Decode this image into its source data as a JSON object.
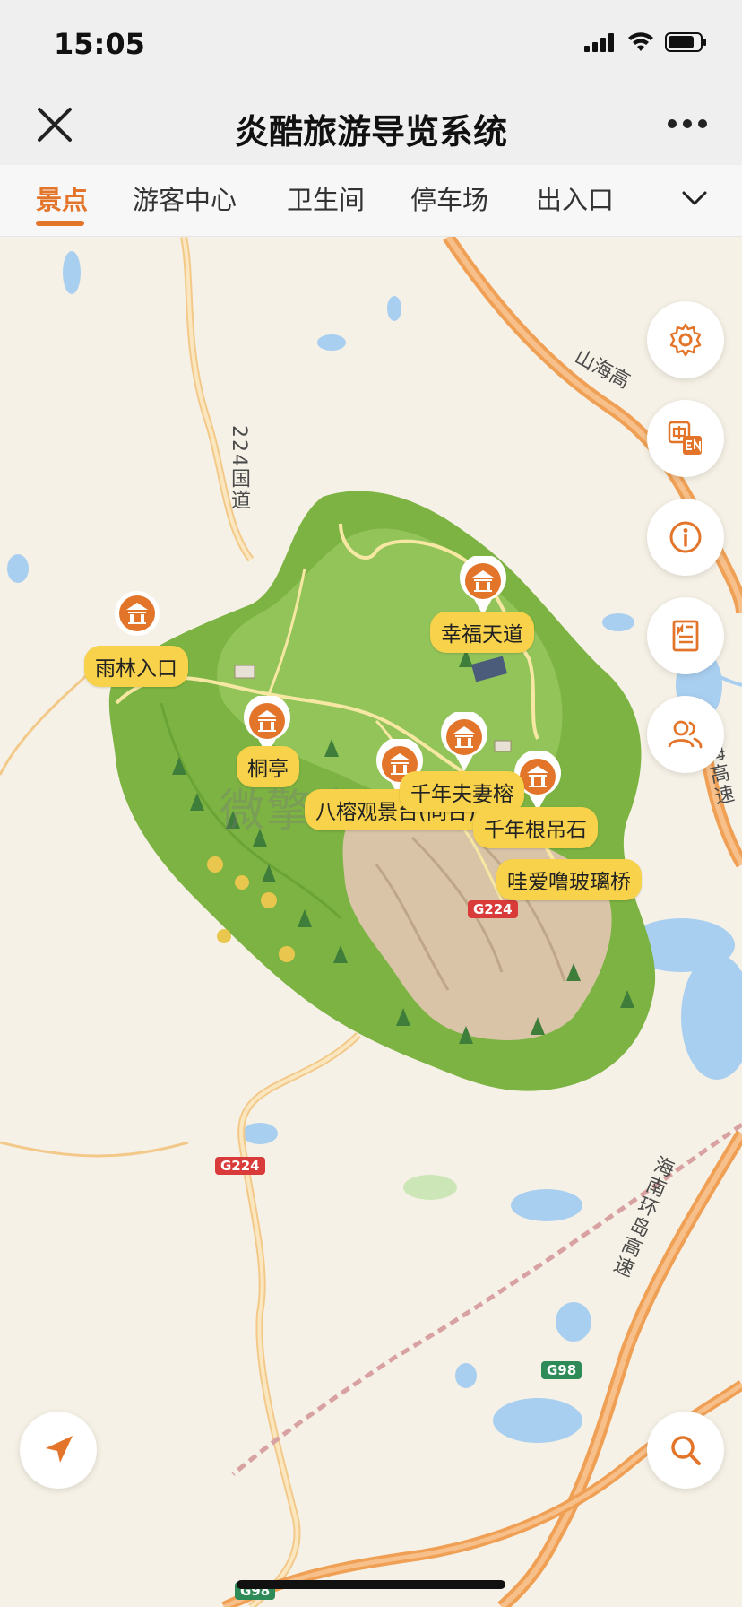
{
  "status_bar": {
    "time": "15:05"
  },
  "nav": {
    "title": "炎酷旅游导览系统"
  },
  "tabs": [
    {
      "label": "景点",
      "active": true
    },
    {
      "label": "游客中心",
      "active": false
    },
    {
      "label": "卫生间",
      "active": false
    },
    {
      "label": "停车场",
      "active": false
    },
    {
      "label": "出入口",
      "active": false
    }
  ],
  "map": {
    "roads": {
      "national_road_vertical": "224国道",
      "expressway_top": "山海高",
      "expressway_right": "山海高速",
      "ring_expressway": "海南环岛高速"
    },
    "shields": {
      "g224_center": "G224",
      "g224_bottom": "G224",
      "g98": "G98",
      "g98_bottom": "G98"
    },
    "watermark": "微擎应用商城",
    "pois": [
      {
        "name": "雨林入口"
      },
      {
        "name": "幸福天道"
      },
      {
        "name": "桐亭"
      },
      {
        "name": "八榕观景台(同台)"
      },
      {
        "name": "千年夫妻榕"
      },
      {
        "name": "千年根吊石"
      },
      {
        "name": "哇爱噜玻璃桥"
      }
    ]
  },
  "floating_buttons": {
    "settings": "settings-icon",
    "language": "language-icon",
    "info": "info-icon",
    "notes": "notes-icon",
    "group": "group-icon",
    "locate": "locate-icon",
    "search": "search-icon"
  },
  "colors": {
    "accent": "#e3752b",
    "label_bg": "#f7d24a",
    "expressway": "#f0a055",
    "park_green": "#7cb342"
  }
}
